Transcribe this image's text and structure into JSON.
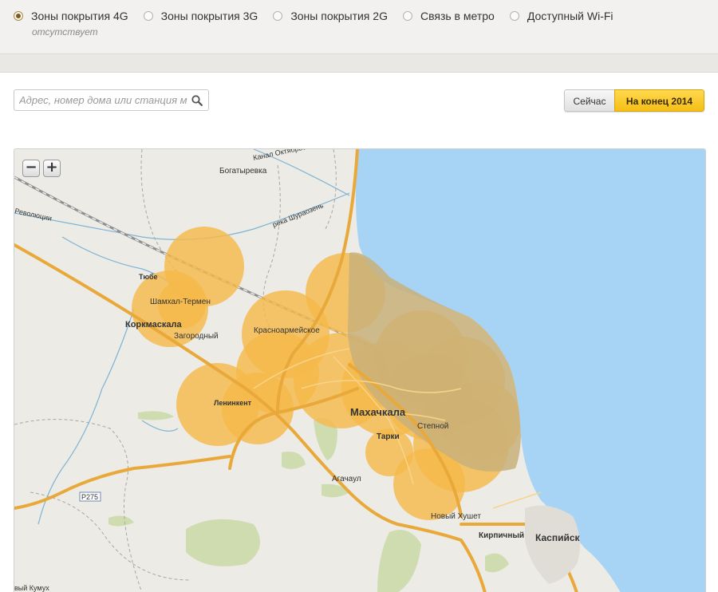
{
  "coverage_tabs": [
    {
      "label": "Зоны покрытия 4G",
      "selected": true
    },
    {
      "label": "Зоны покрытия 3G",
      "selected": false
    },
    {
      "label": "Зоны покрытия 2G",
      "selected": false
    },
    {
      "label": "Связь в метро",
      "selected": false
    },
    {
      "label": "Доступный Wi-Fi",
      "selected": false
    }
  ],
  "status_note": "отсутствует",
  "search": {
    "placeholder": "Адрес, номер дома или станция м"
  },
  "period_buttons": {
    "now": "Сейчас",
    "end_2014": "На конец 2014 г",
    "active": "end_2014"
  },
  "zoom": {
    "out": "−",
    "in": "+"
  },
  "colors": {
    "coverage": "#f5b94a",
    "sea": "#a7d4f5",
    "land": "#ecebe5",
    "active_button": "#f5bf14"
  },
  "map_labels": {
    "bogatyrevka": "Богатыревка",
    "canal": "Канал Октябрьский",
    "river_shurauzen": "река Шураозень",
    "revolyutsii": "Революции",
    "tyube": "Тюбе",
    "shamkhal": "Шамхал-Термен",
    "korkmaskala": "Коркмаскала",
    "zagorodny": "Загородный",
    "krasnoarmeyskoe": "Красноармейское",
    "leninkent": "Ленинкент",
    "makhachkala": "Махачкала",
    "stepnoy": "Степной",
    "tarki": "Тарки",
    "agachaul": "Агачаул",
    "road_badge": "Р275",
    "novy_khushet": "Новый Хушет",
    "kirpichny": "Кирпичный",
    "kaspiysk": "Каспийск",
    "novy_kumukh": "вый Кумух"
  }
}
